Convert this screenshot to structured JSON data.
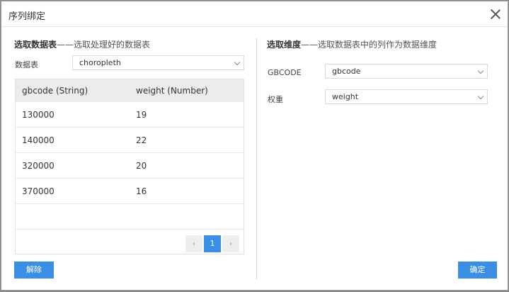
{
  "dialog": {
    "title": "序列绑定"
  },
  "left": {
    "section_title_bold": "选取数据表",
    "section_title_rest": "——选取处理好的数据表",
    "table_label": "数据表",
    "table_value": "choropleth",
    "columns": [
      "gbcode (String)",
      "weight (Number)"
    ],
    "rows": [
      [
        "130000",
        "19"
      ],
      [
        "140000",
        "22"
      ],
      [
        "320000",
        "20"
      ],
      [
        "370000",
        "16"
      ]
    ],
    "pager": {
      "prev": "‹",
      "current": "1",
      "next": "›"
    },
    "unbind_button": "解除"
  },
  "right": {
    "section_title_bold": "选取维度",
    "section_title_rest": "——选取数据表中的列作为数据维度",
    "gbcode_label": "GBCODE",
    "gbcode_value": "gbcode",
    "weight_label": "权重",
    "weight_value": "weight",
    "confirm_button": "确定"
  },
  "colors": {
    "accent": "#3a8ee6",
    "header_bg": "#ececec"
  }
}
